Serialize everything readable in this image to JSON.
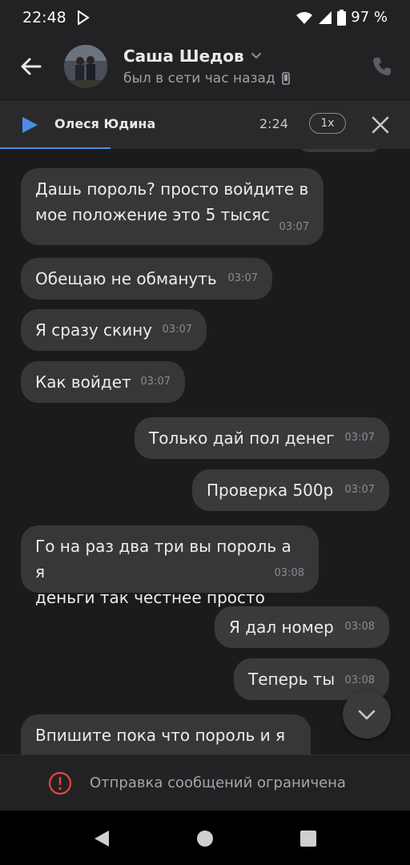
{
  "status_bar": {
    "time": "22:48",
    "battery": "97 %"
  },
  "header": {
    "contact_name": "Саша Шедов",
    "last_seen": "был в сети час назад"
  },
  "audio_player": {
    "artist": "Олеся Юдина",
    "time": "2:24",
    "speed": "1x",
    "progress": 0.27,
    "accent_color": "#4a8fe7"
  },
  "messages": [
    {
      "direction": "in",
      "text_lines": [
        "Дашь пороль? просто войдите в",
        "мое положение это 5 тысяс"
      ],
      "time": "03:07"
    },
    {
      "direction": "in",
      "text": "Обещаю не обмануть",
      "time": "03:07"
    },
    {
      "direction": "in",
      "text": "Я сразу скину",
      "time": "03:07"
    },
    {
      "direction": "in",
      "text": "Как войдет",
      "time": "03:07"
    },
    {
      "direction": "out",
      "text": "Только дай пол денег",
      "time": "03:07"
    },
    {
      "direction": "out",
      "text": "Проверка 500р",
      "time": "03:07"
    },
    {
      "direction": "in",
      "text_lines": [
        "Го на раз два три вы пороль а я",
        "деньги так честнее просто"
      ],
      "time": "03:08"
    },
    {
      "direction": "out",
      "text": "Я дал номер",
      "time": "03:08"
    },
    {
      "direction": "out",
      "text": "Теперь ты",
      "time": "03:08"
    },
    {
      "direction": "in",
      "text": "Впишите пока что пороль и я",
      "time": ""
    }
  ],
  "restriction": {
    "text": "Отправка сообщений ограничена",
    "icon_color": "#e64646"
  },
  "icons": {
    "back": "arrow-left-icon",
    "phone": "phone-icon",
    "play": "play-icon",
    "close": "close-icon",
    "scroll_down": "chevron-down-icon",
    "alert": "alert-circle-icon"
  }
}
